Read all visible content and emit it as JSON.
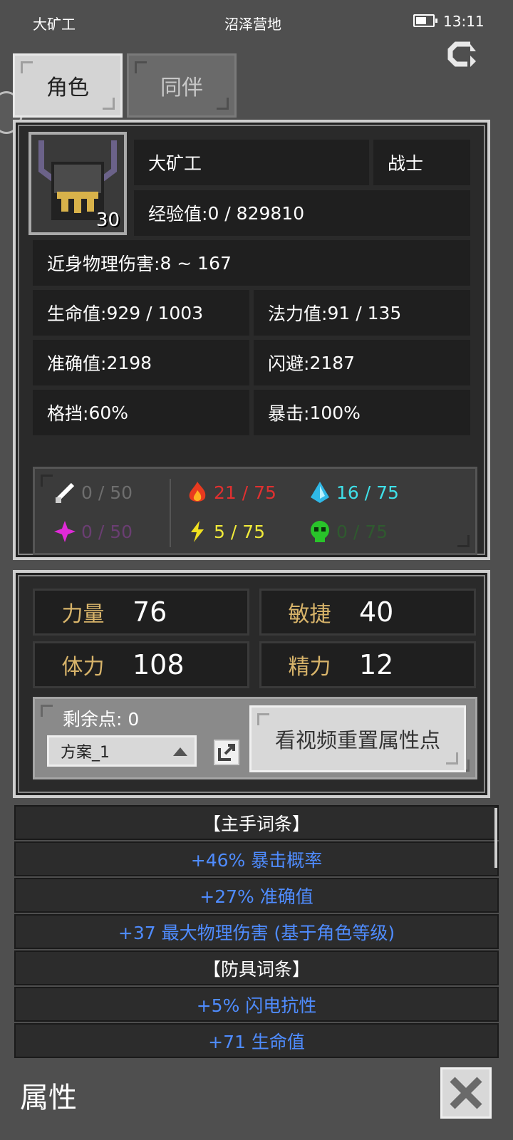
{
  "status_bar": {
    "app_name": "大矿工",
    "location": "沼泽营地",
    "time": "13:11"
  },
  "tabs": [
    {
      "label": "角色",
      "active": true
    },
    {
      "label": "同伴",
      "active": false
    }
  ],
  "character": {
    "name": "大矿工",
    "class": "战士",
    "level": "30",
    "exp_label": "经验值: ",
    "exp_value": "0 / 829810",
    "portrait_icon": "horned-knight-helmet-icon"
  },
  "stats": {
    "melee": {
      "label": "近身物理伤害: ",
      "value": "8 ~ 167"
    },
    "hp": {
      "label": "生命值: ",
      "value": "929 / 1003"
    },
    "mp": {
      "label": "法力值: ",
      "value": "91 / 135"
    },
    "accuracy": {
      "label": "准确值: ",
      "value": "2198"
    },
    "dodge": {
      "label": "闪避: ",
      "value": "2187"
    },
    "block": {
      "label": "格挡: ",
      "value": "60%"
    },
    "crit": {
      "label": "暴击: ",
      "value": "100%"
    }
  },
  "resistances": [
    {
      "icon": "physical-resist-icon",
      "value": "0 / 50",
      "color": "#6e6e6e"
    },
    {
      "icon": "fire-resist-icon",
      "value": "21 / 75",
      "color": "#e03030"
    },
    {
      "icon": "ice-resist-icon",
      "value": "16 / 75",
      "color": "#3fe0e8"
    },
    {
      "icon": "chaos-resist-icon",
      "value": "0 / 50",
      "color": "#6a3e72"
    },
    {
      "icon": "lightning-resist-icon",
      "value": "5 / 75",
      "color": "#f0ea3a"
    },
    {
      "icon": "poison-resist-icon",
      "value": "0 / 75",
      "color": "#2f5a2f"
    }
  ],
  "attributes": [
    {
      "name": "力量",
      "value": "76"
    },
    {
      "name": "敏捷",
      "value": "40"
    },
    {
      "name": "体力",
      "value": "108"
    },
    {
      "name": "精力",
      "value": "12"
    }
  ],
  "points": {
    "remaining_label": "剩余点: ",
    "remaining_value": "0",
    "scheme": "方案_1",
    "reset_button": "看视频重置属性点"
  },
  "affixes": [
    {
      "text": "【主手词条】",
      "header": true
    },
    {
      "text": "+46% 暴击概率",
      "header": false
    },
    {
      "text": "+27% 准确值",
      "header": false
    },
    {
      "text": "+37 最大物理伤害 (基于角色等级)",
      "header": false
    },
    {
      "text": "【防具词条】",
      "header": true
    },
    {
      "text": "+5% 闪电抗性",
      "header": false
    },
    {
      "text": "+71 生命值",
      "header": false
    }
  ],
  "footer": {
    "title": "属性"
  },
  "colors": {
    "affix_blue": "#4f8cff",
    "attr_gold": "#d8b46a"
  }
}
